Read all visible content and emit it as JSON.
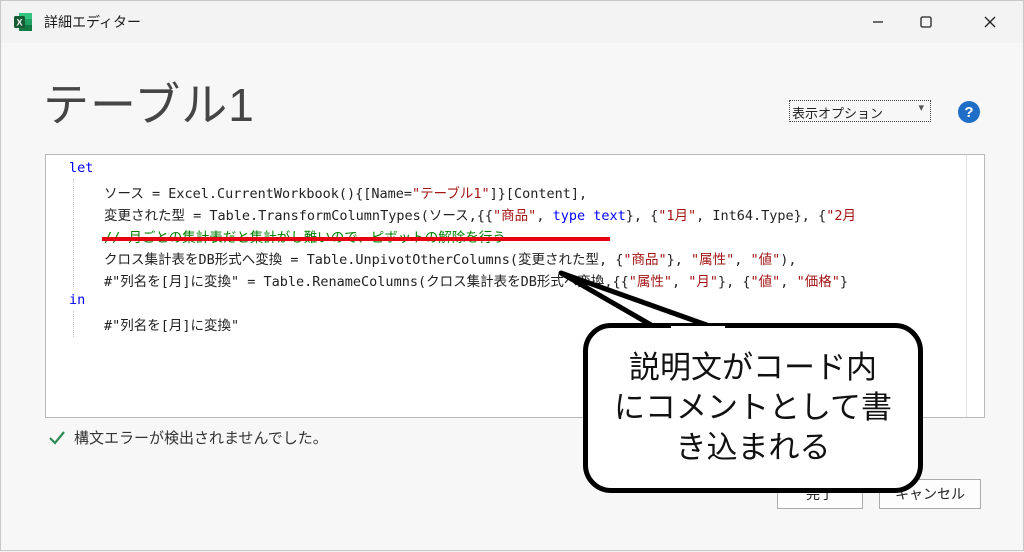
{
  "window": {
    "title": "詳細エディター",
    "app_icon_letter": "X"
  },
  "page": {
    "title": "テーブル1"
  },
  "toolbar": {
    "display_options_label": "表示オプション",
    "help_label": "?"
  },
  "code": {
    "line1_kw": "let",
    "line2_a": "ソース = Excel.CurrentWorkbook(){[Name=",
    "line2_str": "\"テーブル1\"",
    "line2_b": "]}[Content],",
    "line3_a": "変更された型 = Table.TransformColumnTypes(ソース,{{",
    "line3_s1": "\"商品\"",
    "line3_b": ", ",
    "line3_kw": "type text",
    "line3_c": "}, {",
    "line3_s2": "\"1月\"",
    "line3_d": ", Int64.Type}, {",
    "line3_s3": "\"2月",
    "line4_comment": "// 月ごとの集計表だと集計がし難いので、ピボットの解除を行う",
    "line5_a": "クロス集計表をDB形式へ変換 = Table.UnpivotOtherColumns(変更された型, {",
    "line5_s1": "\"商品\"",
    "line5_b": "}, ",
    "line5_s2": "\"属性\"",
    "line5_c": ", ",
    "line5_s3": "\"値\"",
    "line5_d": "),",
    "line6_a": "#\"列名を[月]に変換\" = Table.RenameColumns(クロス集計表をDB形式へ変換,{{",
    "line6_s1": "\"属性\"",
    "line6_b": ", ",
    "line6_s2": "\"月\"",
    "line6_c": "}, {",
    "line6_s3": "\"値\"",
    "line6_d": ", ",
    "line6_s4": "\"価格\"",
    "line6_e": "}",
    "line7_kw": "in",
    "line8": "#\"列名を[月]に変換\""
  },
  "status": {
    "text": "構文エラーが検出されませんでした。"
  },
  "buttons": {
    "done_label": "完了",
    "cancel_label": "キャンセル"
  },
  "callout": {
    "line1": "説明文がコード内",
    "line2": "にコメントとして書",
    "line3": "き込まれる"
  },
  "colors": {
    "keyword": "#0000ff",
    "string": "#a31515",
    "comment": "#008000",
    "underline": "#e60012",
    "help": "#1e6ec7",
    "excel_green": "#1d6f42"
  }
}
